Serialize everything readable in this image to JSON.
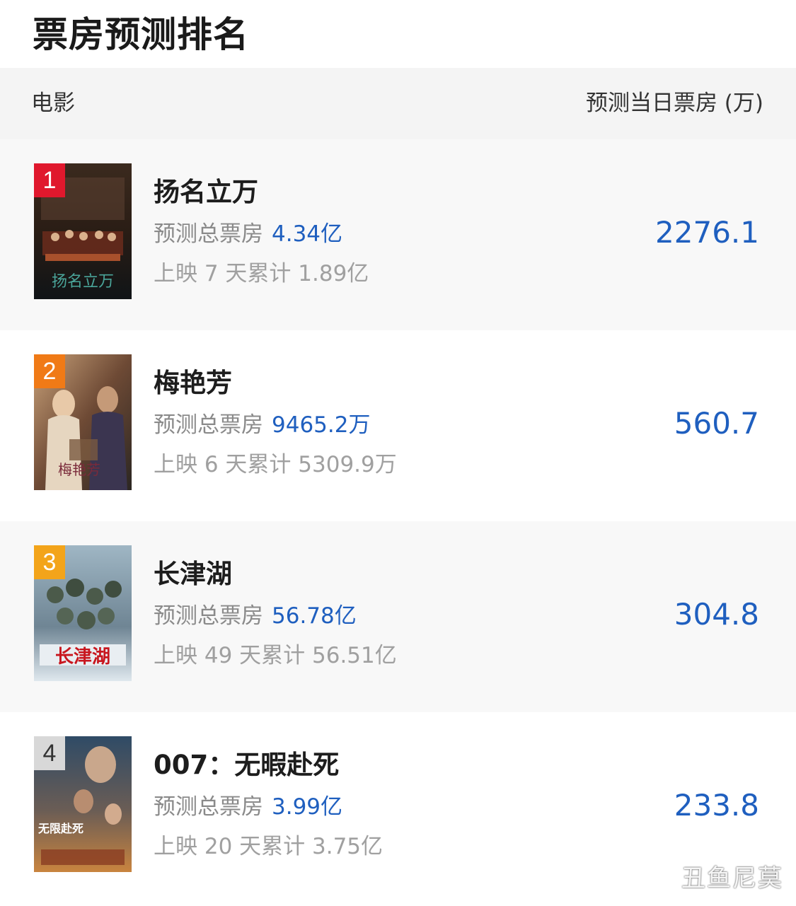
{
  "page": {
    "title": "票房预测排名"
  },
  "table_header": {
    "movie": "电影",
    "forecast": "预测当日票房 (万)"
  },
  "movies": [
    {
      "rank": "1",
      "title": "扬名立万",
      "total_label": "预测总票房",
      "total_value": "4.34亿",
      "cumulative": "上映 7 天累计 1.89亿",
      "forecast": "2276.1",
      "poster_text": "扬名立万"
    },
    {
      "rank": "2",
      "title": "梅艳芳",
      "total_label": "预测总票房",
      "total_value": "9465.2万",
      "cumulative": "上映 6 天累计 5309.9万",
      "forecast": "560.7",
      "poster_text": "梅艳芳"
    },
    {
      "rank": "3",
      "title": "长津湖",
      "total_label": "预测总票房",
      "total_value": "56.78亿",
      "cumulative": "上映 49 天累计 56.51亿",
      "forecast": "304.8",
      "poster_text": "长津湖"
    },
    {
      "rank": "4",
      "title": "007：无暇赴死",
      "total_label": "预测总票房",
      "total_value": "3.99亿",
      "cumulative": "上映 20 天累计 3.75亿",
      "forecast": "233.8",
      "poster_text": "无限赴死"
    }
  ],
  "badge_colors": [
    "#e0182d",
    "#f07a16",
    "#f3a41a",
    "#d8d8d8"
  ],
  "accent_color": "#1f5fbf",
  "watermark": "丑鱼尼莫"
}
